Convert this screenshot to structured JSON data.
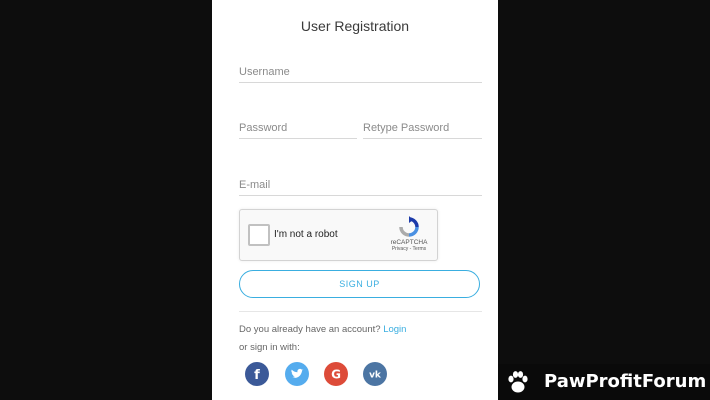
{
  "form": {
    "title": "User Registration",
    "username_placeholder": "Username",
    "password_placeholder": "Password",
    "retype_password_placeholder": "Retype Password",
    "email_placeholder": "E-mail",
    "captcha": {
      "label": "I'm not a robot",
      "brand": "reCAPTCHA",
      "links": "Privacy - Terms"
    },
    "signup_label": "SIGN UP",
    "account_question": "Do you already have an account?",
    "login_link": "Login",
    "or_sign_in": "or sign in with:"
  },
  "social": [
    {
      "name": "facebook-icon",
      "glyph": "f",
      "color": "#3b5998"
    },
    {
      "name": "twitter-icon",
      "glyph": "t",
      "color": "#55acee"
    },
    {
      "name": "google-icon",
      "glyph": "G",
      "color": "#dd4b39"
    },
    {
      "name": "vk-icon",
      "glyph": "vk",
      "color": "#4c75a3"
    }
  ],
  "watermark": {
    "text": "PawProfitForum",
    "icon": "paw-icon"
  },
  "colors": {
    "accent": "#3aaee0",
    "background": "#0d0d0d",
    "panel": "#ffffff"
  }
}
